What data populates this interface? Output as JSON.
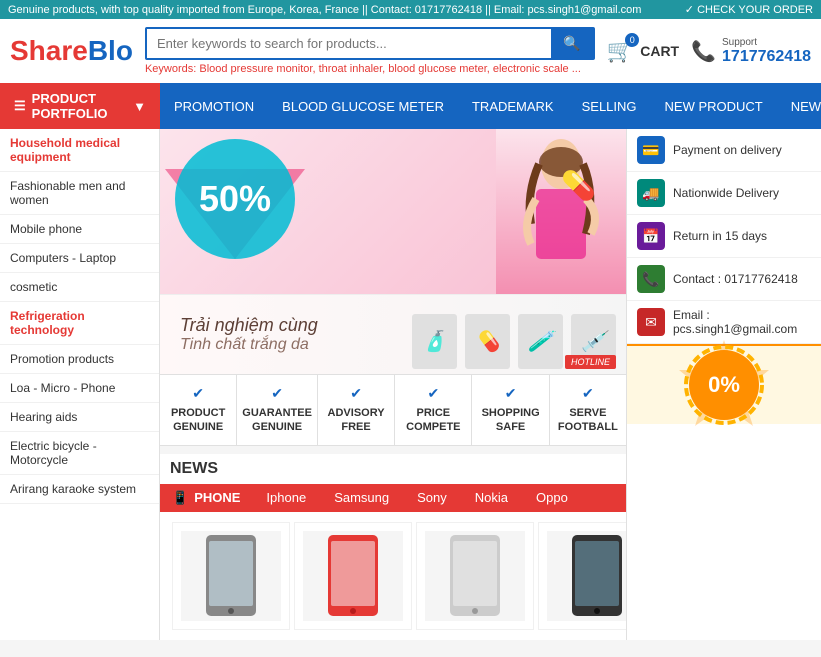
{
  "topbar": {
    "left_text": "Genuine products, with top quality imported from Europe, Korea, France || Contact: 01717762418 || Email: pcs.singh1@gmail.com",
    "right_text": "✓ CHECK YOUR ORDER"
  },
  "header": {
    "logo_share": "Share",
    "logo_blo": "Blo",
    "search_placeholder": "Enter keywords to search for products...",
    "keywords_label": "Keywords:",
    "keywords": "Blood pressure monitor, throat inhaler, blood glucose meter, electronic scale ...",
    "cart_count": "0",
    "cart_label": "CART",
    "support_label": "Support",
    "phone_number": "1717762418"
  },
  "nav": {
    "product_portfolio": "PRODUCT PORTFOLIO",
    "items": [
      {
        "label": "PROMOTION"
      },
      {
        "label": "BLOOD GLUCOSE METER"
      },
      {
        "label": "TRADEMARK"
      },
      {
        "label": "SELLING"
      },
      {
        "label": "NEW PRODUCT"
      },
      {
        "label": "NEWS"
      }
    ]
  },
  "sidebar": {
    "title": "PROduct PORTFOLIO",
    "items": [
      {
        "label": "Household medical equipment",
        "highlight": true
      },
      {
        "label": "Fashionable men and women"
      },
      {
        "label": "Mobile phone"
      },
      {
        "label": "Computers - Laptop"
      },
      {
        "label": "cosmetic"
      },
      {
        "label": "Refrigeration technology",
        "highlight": true
      },
      {
        "label": "Promotion products"
      },
      {
        "label": "Loa - Micro - Phone"
      },
      {
        "label": "Hearing aids"
      },
      {
        "label": "Electric bicycle - Motorcycle"
      },
      {
        "label": "Arirang karaoke system"
      }
    ]
  },
  "banner": {
    "percent": "50%",
    "banner2_text_line1": "Trải nghiệm cùng",
    "banner2_text_line2": "Tinh chất trắng da"
  },
  "right_info": {
    "items": [
      {
        "icon": "💳",
        "icon_class": "icon-blue",
        "label": "Payment on delivery"
      },
      {
        "icon": "🚚",
        "icon_class": "icon-teal",
        "label": "Nationwide Delivery"
      },
      {
        "icon": "📅",
        "icon_class": "icon-purple",
        "label": "Return in 15 days"
      },
      {
        "icon": "📞",
        "icon_class": "icon-green",
        "label": "Contact : 01717762418"
      },
      {
        "icon": "✉",
        "icon_class": "icon-red",
        "label": "Email : pcs.singh1@gmail.com"
      }
    ],
    "badge_0": "0%"
  },
  "features": {
    "items": [
      {
        "label": "PRODUCT\nGENUINE"
      },
      {
        "label": "GUARANTEE\nGENUINE"
      },
      {
        "label": "ADVISORY\nFREE"
      },
      {
        "label": "PRICE\nCOMPETE"
      },
      {
        "label": "SHOPPING\nSAFE"
      },
      {
        "label": "SERVE\nFOOTBALL"
      }
    ]
  },
  "news": {
    "title": "NEWS",
    "tab_label": "PHONE",
    "tabs": [
      {
        "label": "Iphone"
      },
      {
        "label": "Samsung"
      },
      {
        "label": "Sony"
      },
      {
        "label": "Nokia"
      },
      {
        "label": "Oppo"
      }
    ]
  },
  "products": {
    "items": [
      {
        "emoji": "📱",
        "color": "#e0e0e0"
      },
      {
        "emoji": "📱",
        "color": "#e0e0e0"
      },
      {
        "emoji": "📱",
        "color": "#e0e0e0"
      },
      {
        "emoji": "📱",
        "color": "#e0e0e0"
      },
      {
        "emoji": "📱",
        "color": "#e0e0e0"
      },
      {
        "emoji": "📱",
        "color": "#e0e0e0"
      }
    ]
  }
}
